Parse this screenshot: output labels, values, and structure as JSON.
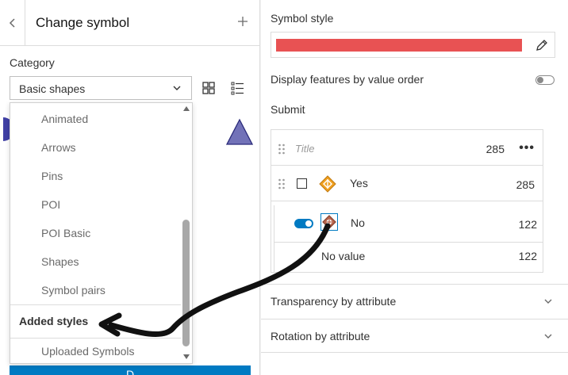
{
  "left_panel": {
    "back_icon": "chevron-left-icon",
    "title": "Change symbol",
    "add_icon": "plus-icon",
    "category_label": "Category",
    "category_value": "Basic shapes",
    "view_icons": [
      "grid-view-icon",
      "list-view-icon"
    ],
    "done_label": "D"
  },
  "dropdown": {
    "items": [
      "Animated",
      "Arrows",
      "Pins",
      "POI",
      "POI Basic",
      "Shapes",
      "Symbol pairs"
    ],
    "group_heading": "Added styles",
    "group_items": [
      "Uploaded Symbols"
    ]
  },
  "right_panel": {
    "symbol_style_label": "Symbol style",
    "symbol_style_color": "#e85253",
    "edit_icon": "pencil-icon",
    "order_label": "Display features by value order",
    "order_enabled": false,
    "field_label": "Submit",
    "value_list": {
      "title_placeholder": "Title",
      "title_count": "285",
      "more_icon": "ellipsis-icon",
      "rows": [
        {
          "label": "Yes",
          "count": "285",
          "symbol_color": "#f0a020"
        },
        {
          "label": "No",
          "count": "122",
          "symbol_color": "#b5624a",
          "visible": true
        }
      ],
      "no_value_label": "No value",
      "no_value_count": "122"
    },
    "sections": [
      "Transparency by attribute",
      "Rotation by attribute"
    ]
  },
  "accent_color": "#007ac2"
}
